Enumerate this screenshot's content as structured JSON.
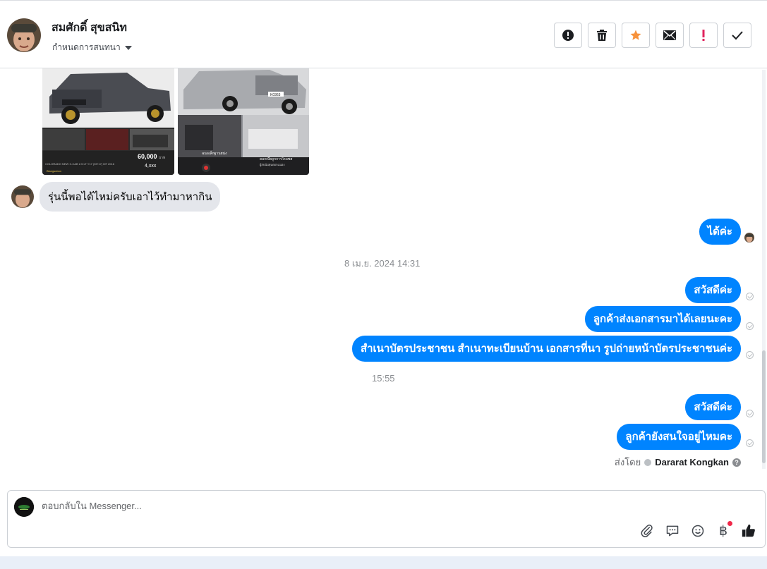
{
  "header": {
    "contact_name": "สมศักดิ์ สุขสนิท",
    "assign_label": "กำหนดการสนทนา",
    "actions": [
      {
        "name": "spam-button",
        "icon": "alert-circle-icon"
      },
      {
        "name": "delete-button",
        "icon": "trash-icon"
      },
      {
        "name": "star-button",
        "icon": "star-icon",
        "color": "#f7923b"
      },
      {
        "name": "mark-unread-button",
        "icon": "envelope-icon"
      },
      {
        "name": "follow-up-button",
        "icon": "exclamation-icon",
        "color": "#e0245e"
      },
      {
        "name": "mark-done-button",
        "icon": "check-icon"
      }
    ]
  },
  "thread": {
    "photo1": {
      "price": "60,000",
      "price_unit": "บาท",
      "installment": "4,xxx",
      "caption": "COLORADO NEW X-CAB 2.5 LT Y17 (MY17) MT 2016",
      "dealer": "Blangsubon"
    },
    "photo2": {
      "plate": "K0363",
      "caption": "ฉนอเล็กฐานยน่ง",
      "caption2": "ดอกเบี้ยถูกการไรอซส",
      "caption3": "ผู้สบนันทุนดอกเนเอง"
    },
    "incoming_message": "รุ่นนี้พอได้ไหม่ครับเอาไว้ทำมาหากิน",
    "reply_1": "ได้ค่ะ",
    "timestamp_1": "8 เม.ย. 2024 14:31",
    "group_1": [
      "สวัสดีค่ะ",
      "ลูกค้าส่งเอกสารมาได้เลยนะคะ",
      "สำเนาบัตรประชาชน สำเนาทะเบียนบ้าน เอกสารที่นา รูปถ่ายหน้าบัตรประชาชนค่ะ"
    ],
    "timestamp_2": "15:55",
    "group_2": [
      "สวัสดีค่ะ",
      "ลูกค้ายังสนใจอยู่ไหมคะ"
    ],
    "sent_by_label": "ส่งโดย",
    "sent_by_name": "Dararat Kongkan"
  },
  "composer": {
    "placeholder": "ตอบกลับใน Messenger...",
    "tools": [
      "paperclip-icon",
      "saved-reply-icon",
      "emoji-icon",
      "baht-payment-icon",
      "like-icon"
    ],
    "baht_symbol": "฿"
  },
  "colors": {
    "accent": "#0084ff",
    "incoming_bubble": "#e4e6eb"
  }
}
